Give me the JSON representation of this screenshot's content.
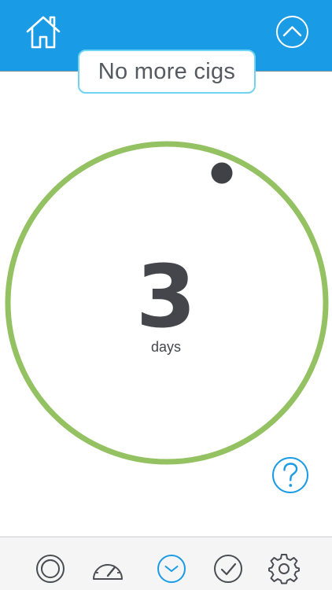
{
  "header": {
    "home_icon": "home-icon",
    "collapse_icon": "chevron-up-icon",
    "background_color": "#1a9be6"
  },
  "title": {
    "text": "No more cigs",
    "border_color": "#6fd3f2"
  },
  "timer": {
    "value": "3",
    "unit": "days",
    "ring_color": "#94c162",
    "indicator_color": "#3f4146"
  },
  "help": {
    "icon": "question-icon",
    "color": "#1a9be6"
  },
  "tabbar": {
    "tabs": [
      {
        "icon": "rings-icon",
        "active": false
      },
      {
        "icon": "speedometer-icon",
        "active": false
      },
      {
        "icon": "clock-icon",
        "active": true
      },
      {
        "icon": "checkmark-icon",
        "active": false
      },
      {
        "icon": "gear-icon",
        "active": false
      }
    ],
    "active_color": "#1a9be6",
    "inactive_color": "#4a4d52"
  }
}
